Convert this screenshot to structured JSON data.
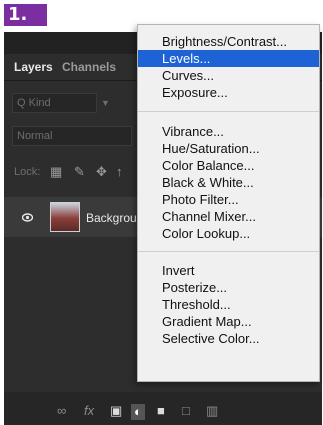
{
  "step": {
    "label": "1."
  },
  "tabs": {
    "active": "Layers",
    "inactive": "Channels"
  },
  "search": {
    "placeholder": "Q Kind"
  },
  "blend_mode": {
    "value": "Normal"
  },
  "lock": {
    "label": "Lock:"
  },
  "layer": {
    "name": "Background"
  },
  "menu": {
    "groups": [
      [
        "Brightness/Contrast...",
        "Levels...",
        "Curves...",
        "Exposure..."
      ],
      [
        "Vibrance...",
        "Hue/Saturation...",
        "Color Balance...",
        "Black & White...",
        "Photo Filter...",
        "Channel Mixer...",
        "Color Lookup..."
      ],
      [
        "Invert",
        "Posterize...",
        "Threshold...",
        "Gradient Map...",
        "Selective Color..."
      ]
    ],
    "highlighted": "Levels..."
  },
  "footer_icons": [
    "link-icon",
    "fx-icon",
    "mask-icon",
    "adjustment-layer-icon",
    "folder-icon",
    "new-layer-icon",
    "trash-icon"
  ],
  "colors": {
    "accent": "#1e63d6",
    "badge": "#7a2ea0",
    "panel": "#2d2d2d",
    "menu_bg": "#f0f0f0"
  }
}
